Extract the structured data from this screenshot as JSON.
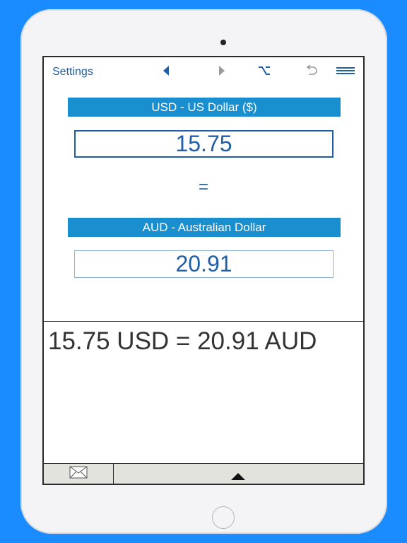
{
  "toolbar": {
    "settings_label": "Settings",
    "icons": [
      "previous-icon",
      "next-icon",
      "option-key-icon",
      "undo-icon",
      "menu-icon"
    ]
  },
  "from": {
    "currency_label": "USD - US Dollar ($)",
    "amount": "15.75"
  },
  "equals": "=",
  "to": {
    "currency_label": "AUD - Australian Dollar",
    "amount": "20.91"
  },
  "result_line": "15.75 USD = 20.91 AUD",
  "bottom_bar": {
    "icons": [
      "mail-icon",
      "expand-up-icon"
    ]
  },
  "colors": {
    "background": "#1a8cff",
    "accent": "#1a8fd0",
    "text_blue": "#1f5fa8",
    "bottom_bar": "#e3e3de"
  }
}
